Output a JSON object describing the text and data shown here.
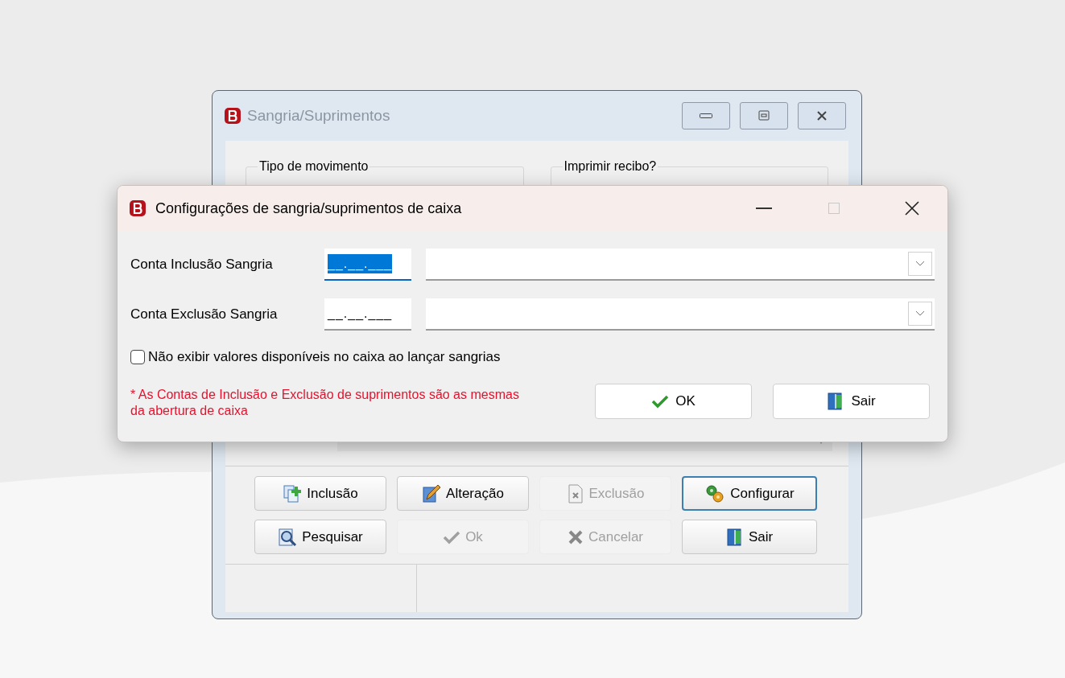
{
  "background_window": {
    "title": "Sangria/Suprimentos",
    "active": false,
    "group_boxes": [
      {
        "label": "Tipo de movimento"
      },
      {
        "label": "Imprimir recibo?"
      }
    ],
    "buttons": [
      {
        "label": "Inclusão",
        "kind": "add",
        "disabled": false,
        "focused": false
      },
      {
        "label": "Alteração",
        "kind": "edit",
        "disabled": false,
        "focused": false
      },
      {
        "label": "Exclusão",
        "kind": "delete",
        "disabled": true,
        "focused": false
      },
      {
        "label": "Configurar",
        "kind": "config",
        "disabled": false,
        "focused": true
      },
      {
        "label": "Pesquisar",
        "kind": "search",
        "disabled": false,
        "focused": false
      },
      {
        "label": "Ok",
        "kind": "check",
        "disabled": true,
        "focused": false
      },
      {
        "label": "Cancelar",
        "kind": "cancel",
        "disabled": true,
        "focused": false
      },
      {
        "label": "Sair",
        "kind": "exit",
        "disabled": false,
        "focused": false
      }
    ]
  },
  "dialog": {
    "title": "Configurações de sangria/suprimentos de caixa",
    "fields": [
      {
        "label": "Conta Inclusão Sangria",
        "value": "__.__.___",
        "focused": true
      },
      {
        "label": "Conta Exclusão Sangria",
        "value": "__.__.___",
        "focused": false
      }
    ],
    "checkbox": {
      "label": "Não exibir valores disponíveis no caixa ao lançar sangrias",
      "checked": false
    },
    "note": "* As Contas de Inclusão e Exclusão de suprimentos são as mesmas da abertura de caixa",
    "buttons": [
      {
        "label": "OK",
        "kind": "check"
      },
      {
        "label": "Sair",
        "kind": "exit"
      }
    ]
  }
}
